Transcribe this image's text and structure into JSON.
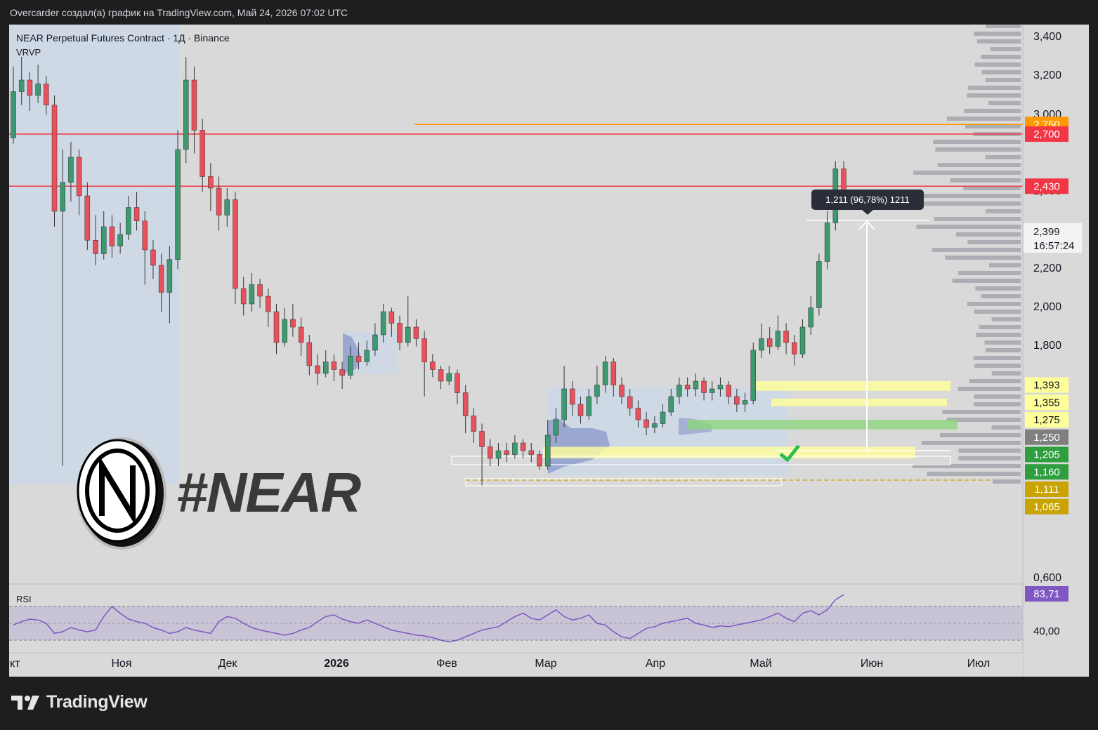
{
  "header": {
    "attribution": "Overcarder создал(а) график на TradingView.com, Май 24, 2026 07:02 UTC"
  },
  "chart_data": {
    "type": "candlestick",
    "title": "NEAR Perpetual Futures Contract · 1Д · Binance",
    "indicator_label": "VRVP",
    "watermark_text": "#NEAR",
    "y_axis_ticks": [
      "3,400",
      "3,200",
      "3,000",
      "2,600",
      "2,200",
      "2,000",
      "1,800",
      "1,600",
      "0,600"
    ],
    "x_axis_ticks": [
      "Окт",
      "Ноя",
      "Дек",
      "2026",
      "Фев",
      "Мар",
      "Апр",
      "Май",
      "Июн",
      "Июл"
    ],
    "price_labels": [
      {
        "text": "2,750",
        "value": 2.75,
        "color": "#ff9800"
      },
      {
        "text": "2,700",
        "value": 2.7,
        "color": "#f23645"
      },
      {
        "text": "2,430",
        "value": 2.43,
        "color": "#f23645"
      },
      {
        "text": "1,393",
        "value": 1.4,
        "color": "#ffff99"
      },
      {
        "text": "1,355",
        "value": 1.31,
        "color": "#ffff99"
      },
      {
        "text": "1,275",
        "value": 1.22,
        "color": "#ffff99"
      },
      {
        "text": "1,250",
        "value": 1.13,
        "color": "#7f7f7f"
      },
      {
        "text": "1,205",
        "value": 1.04,
        "color": "#2e9e3f"
      },
      {
        "text": "1,160",
        "value": 0.95,
        "color": "#2e9e3f"
      },
      {
        "text": "1,111",
        "value": 0.86,
        "color": "#c9a400"
      },
      {
        "text": "1,065",
        "value": 0.77,
        "color": "#c9a400"
      }
    ],
    "current_price": {
      "text": "2,399",
      "value": 2.4,
      "countdown": "16:57:24"
    },
    "measure_tooltip": "1,211 (96,78%) 1211",
    "horizontal_levels": [
      {
        "value": 2.75,
        "color": "#ff9800"
      },
      {
        "value": 2.7,
        "color": "#f23645"
      },
      {
        "value": 2.43,
        "color": "#f23645"
      }
    ],
    "zones": [
      {
        "low": 1.37,
        "high": 1.42,
        "color": "#ffff99"
      },
      {
        "low": 1.29,
        "high": 1.33,
        "color": "#ffff99"
      },
      {
        "low": 1.17,
        "high": 1.22,
        "color": "#8fd67f"
      },
      {
        "low": 1.02,
        "high": 1.08,
        "color": "#ffff99"
      }
    ],
    "rsi": {
      "label": "RSI",
      "last": "83,71",
      "tick": "40,00",
      "upper": 70,
      "lower": 30,
      "values": [
        48,
        52,
        55,
        54,
        50,
        38,
        40,
        45,
        42,
        40,
        42,
        58,
        70,
        62,
        55,
        52,
        50,
        45,
        42,
        38,
        40,
        45,
        42,
        40,
        38,
        52,
        58,
        56,
        50,
        45,
        42,
        40,
        38,
        36,
        38,
        42,
        45,
        52,
        58,
        60,
        55,
        52,
        50,
        54,
        50,
        46,
        42,
        40,
        38,
        36,
        35,
        33,
        30,
        28,
        30,
        34,
        38,
        42,
        44,
        46,
        52,
        58,
        62,
        56,
        54,
        60,
        66,
        58,
        54,
        56,
        60,
        50,
        48,
        40,
        34,
        32,
        38,
        44,
        46,
        50,
        52,
        54,
        56,
        50,
        48,
        45,
        47,
        46,
        48,
        50,
        52,
        54,
        58,
        62,
        56,
        52,
        62,
        65,
        60,
        66,
        78,
        84
      ]
    },
    "candles": [
      [
        2.68,
        2.92,
        3.05,
        2.65
      ],
      [
        2.92,
        2.98,
        3.1,
        2.85
      ],
      [
        2.98,
        2.9,
        3.02,
        2.82
      ],
      [
        2.9,
        2.96,
        3.06,
        2.86
      ],
      [
        2.96,
        2.85,
        3.0,
        2.8
      ],
      [
        2.85,
        2.3,
        2.9,
        2.22
      ],
      [
        2.3,
        2.45,
        2.62,
        0.98
      ],
      [
        2.45,
        2.58,
        2.66,
        2.35
      ],
      [
        2.58,
        2.38,
        2.62,
        2.28
      ],
      [
        2.38,
        2.15,
        2.45,
        2.1
      ],
      [
        2.15,
        2.08,
        2.28,
        2.02
      ],
      [
        2.08,
        2.22,
        2.3,
        2.05
      ],
      [
        2.22,
        2.12,
        2.28,
        2.06
      ],
      [
        2.12,
        2.18,
        2.24,
        2.08
      ],
      [
        2.18,
        2.32,
        2.38,
        2.15
      ],
      [
        2.32,
        2.25,
        2.4,
        2.2
      ],
      [
        2.25,
        2.1,
        2.3,
        1.92
      ],
      [
        2.1,
        2.02,
        2.15,
        1.95
      ],
      [
        2.02,
        1.88,
        2.08,
        1.78
      ],
      [
        1.88,
        2.05,
        2.12,
        1.72
      ],
      [
        2.05,
        2.62,
        2.72,
        2.0
      ],
      [
        2.62,
        2.98,
        3.1,
        2.55
      ],
      [
        2.98,
        2.72,
        3.05,
        2.6
      ],
      [
        2.72,
        2.48,
        2.78,
        2.4
      ],
      [
        2.48,
        2.42,
        2.55,
        2.3
      ],
      [
        2.42,
        2.28,
        2.48,
        2.2
      ],
      [
        2.28,
        2.36,
        2.42,
        2.22
      ],
      [
        2.36,
        1.9,
        2.4,
        1.82
      ],
      [
        1.9,
        1.82,
        1.96,
        1.76
      ],
      [
        1.82,
        1.92,
        1.98,
        1.78
      ],
      [
        1.92,
        1.86,
        1.95,
        1.8
      ],
      [
        1.86,
        1.78,
        1.9,
        1.7
      ],
      [
        1.78,
        1.62,
        1.82,
        1.56
      ],
      [
        1.62,
        1.74,
        1.8,
        1.6
      ],
      [
        1.74,
        1.7,
        1.82,
        1.65
      ],
      [
        1.7,
        1.62,
        1.75,
        1.55
      ],
      [
        1.62,
        1.5,
        1.66,
        1.45
      ],
      [
        1.5,
        1.46,
        1.56,
        1.4
      ],
      [
        1.46,
        1.52,
        1.58,
        1.44
      ],
      [
        1.52,
        1.48,
        1.56,
        1.42
      ],
      [
        1.48,
        1.45,
        1.52,
        1.38
      ],
      [
        1.45,
        1.55,
        1.6,
        1.43
      ],
      [
        1.55,
        1.52,
        1.62,
        1.48
      ],
      [
        1.52,
        1.58,
        1.63,
        1.5
      ],
      [
        1.58,
        1.66,
        1.72,
        1.55
      ],
      [
        1.66,
        1.78,
        1.82,
        1.62
      ],
      [
        1.78,
        1.72,
        1.8,
        1.65
      ],
      [
        1.72,
        1.62,
        1.76,
        1.58
      ],
      [
        1.62,
        1.7,
        1.86,
        1.6
      ],
      [
        1.7,
        1.64,
        1.74,
        1.6
      ],
      [
        1.64,
        1.52,
        1.68,
        1.34
      ],
      [
        1.52,
        1.48,
        1.56,
        1.44
      ],
      [
        1.48,
        1.42,
        1.5,
        1.38
      ],
      [
        1.42,
        1.46,
        1.5,
        1.4
      ],
      [
        1.46,
        1.36,
        1.48,
        1.3
      ],
      [
        1.36,
        1.24,
        1.4,
        1.15
      ],
      [
        1.24,
        1.16,
        1.28,
        1.1
      ],
      [
        1.16,
        1.08,
        1.2,
        0.88
      ],
      [
        1.08,
        1.02,
        1.12,
        0.98
      ],
      [
        1.02,
        1.06,
        1.1,
        0.98
      ],
      [
        1.06,
        1.04,
        1.1,
        1.0
      ],
      [
        1.04,
        1.1,
        1.14,
        1.02
      ],
      [
        1.1,
        1.06,
        1.12,
        1.02
      ],
      [
        1.06,
        1.04,
        1.1,
        1.0
      ],
      [
        1.04,
        0.98,
        1.06,
        0.96
      ],
      [
        0.98,
        1.14,
        1.22,
        0.96
      ],
      [
        1.14,
        1.22,
        1.28,
        1.1
      ],
      [
        1.22,
        1.38,
        1.5,
        1.18
      ],
      [
        1.38,
        1.3,
        1.42,
        1.24
      ],
      [
        1.3,
        1.24,
        1.34,
        1.2
      ],
      [
        1.24,
        1.34,
        1.38,
        1.22
      ],
      [
        1.34,
        1.4,
        1.5,
        1.3
      ],
      [
        1.4,
        1.52,
        1.55,
        1.36
      ],
      [
        1.52,
        1.4,
        1.54,
        1.34
      ],
      [
        1.4,
        1.34,
        1.44,
        1.3
      ],
      [
        1.34,
        1.28,
        1.38,
        1.24
      ],
      [
        1.28,
        1.22,
        1.32,
        1.18
      ],
      [
        1.22,
        1.18,
        1.26,
        1.14
      ],
      [
        1.18,
        1.2,
        1.24,
        1.15
      ],
      [
        1.2,
        1.26,
        1.3,
        1.18
      ],
      [
        1.26,
        1.34,
        1.38,
        1.24
      ],
      [
        1.34,
        1.4,
        1.44,
        1.3
      ],
      [
        1.4,
        1.38,
        1.44,
        1.34
      ],
      [
        1.38,
        1.42,
        1.46,
        1.34
      ],
      [
        1.42,
        1.36,
        1.44,
        1.32
      ],
      [
        1.36,
        1.38,
        1.42,
        1.32
      ],
      [
        1.38,
        1.4,
        1.44,
        1.34
      ],
      [
        1.4,
        1.34,
        1.42,
        1.3
      ],
      [
        1.34,
        1.3,
        1.38,
        1.26
      ],
      [
        1.3,
        1.32,
        1.36,
        1.26
      ],
      [
        1.32,
        1.58,
        1.62,
        1.3
      ],
      [
        1.58,
        1.64,
        1.72,
        1.54
      ],
      [
        1.64,
        1.6,
        1.7,
        1.56
      ],
      [
        1.6,
        1.68,
        1.76,
        1.58
      ],
      [
        1.68,
        1.62,
        1.72,
        1.56
      ],
      [
        1.62,
        1.56,
        1.66,
        1.5
      ],
      [
        1.56,
        1.7,
        1.74,
        1.54
      ],
      [
        1.7,
        1.8,
        1.86,
        1.66
      ],
      [
        1.8,
        2.04,
        2.08,
        1.76
      ],
      [
        2.04,
        2.24,
        2.3,
        2.0
      ],
      [
        2.24,
        2.52,
        2.56,
        2.2
      ],
      [
        2.52,
        2.4,
        2.56,
        2.36
      ]
    ]
  }
}
